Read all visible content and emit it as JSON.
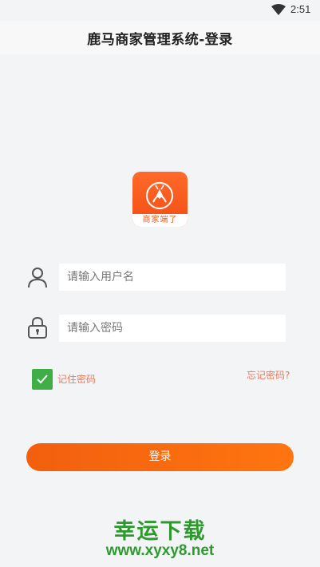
{
  "status_bar": {
    "time": "2:51",
    "wifi_icon": "wifi-icon"
  },
  "header": {
    "title": "鹿马商家管理系统-登录"
  },
  "logo": {
    "text": "商家端了",
    "icon": "deer-logo-icon"
  },
  "form": {
    "username": {
      "placeholder": "请输入用户名",
      "value": "",
      "icon": "user-icon"
    },
    "password": {
      "placeholder": "请输入密码",
      "value": "",
      "icon": "lock-icon"
    },
    "remember": {
      "label": "记住密码",
      "checked": true
    },
    "forgot_label": "忘记密码?",
    "login_label": "登录"
  },
  "watermark": {
    "title": "幸运下载",
    "url": "www.xyxy8.net"
  },
  "colors": {
    "accent": "#f25f0e",
    "checkbox": "#3fae47",
    "link": "#e87a5a",
    "watermark": "#2e9a2e"
  }
}
